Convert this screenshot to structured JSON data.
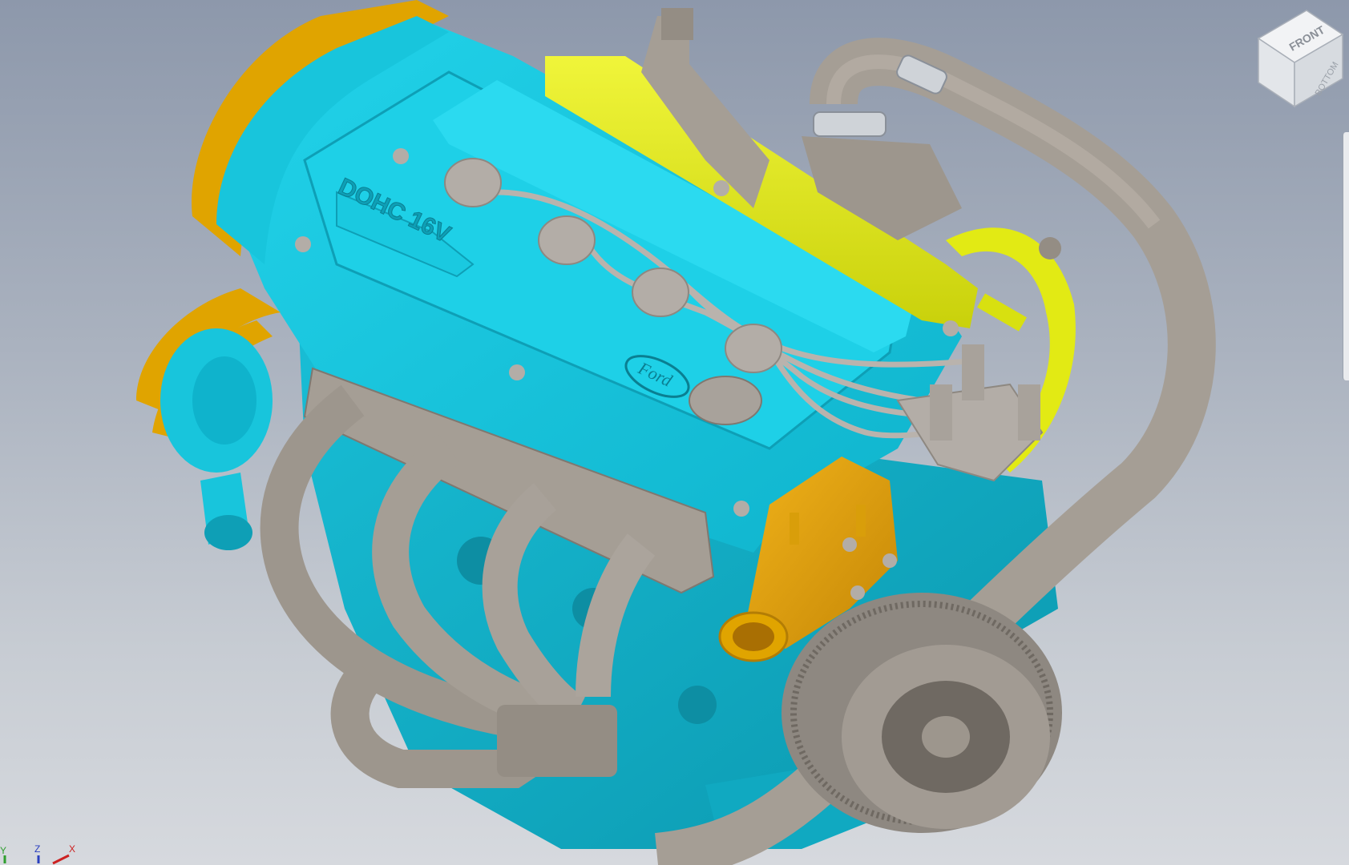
{
  "viewport": {
    "background_top": "#8d98ab",
    "background_bottom": "#d6d9de"
  },
  "colors": {
    "head": "#18c5dc",
    "head_shadow": "#0e9fb6",
    "pipe": "#a59e95",
    "pipe_shadow": "#7f7870",
    "rail": "#e2ea14",
    "belt": "#e0a400",
    "housing": "#d99e0a"
  },
  "model": {
    "cam_cover_text": "DOHC 16V",
    "badge_text": "Ford"
  },
  "viewcube": {
    "top_face": "FRONT",
    "side_face": "BOTTOM"
  },
  "triad": {
    "y_label": "Y",
    "z_label": "Z",
    "x_label": "X"
  }
}
